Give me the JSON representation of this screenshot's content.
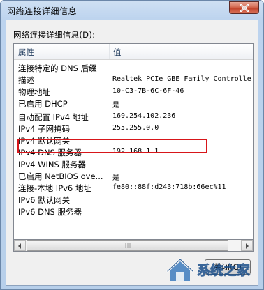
{
  "window": {
    "title": "网络连接详细信息",
    "close_icon": "close-x-icon"
  },
  "section_label": "网络连接详细信息(D):",
  "columns": {
    "property": "属性",
    "value": "值"
  },
  "rows": [
    {
      "name": "连接特定的 DNS 后缀",
      "value": ""
    },
    {
      "name": "描述",
      "value": "Realtek PCIe GBE Family Controlle"
    },
    {
      "name": "物理地址",
      "value": "10-C3-7B-6C-6F-46"
    },
    {
      "name": "已启用 DHCP",
      "value": "是"
    },
    {
      "name": "自动配置 IPv4 地址",
      "value": "169.254.102.236"
    },
    {
      "name": "IPv4 子网掩码",
      "value": "255.255.0.0"
    },
    {
      "name": "IPv4 默认网关",
      "value": ""
    },
    {
      "name": "IPv4 DNS 服务器",
      "value": "192.168.1.1"
    },
    {
      "name": "IPv4 WINS 服务器",
      "value": ""
    },
    {
      "name": "已启用 NetBIOS ove...",
      "value": "是"
    },
    {
      "name": "连接-本地 IPv6 地址",
      "value": "fe80::88f:d243:718b:66ec%11"
    },
    {
      "name": "IPv6 默认网关",
      "value": ""
    },
    {
      "name": "IPv6 DNS 服务器",
      "value": ""
    }
  ],
  "highlight_color": "#d7161a",
  "close_button_label": "关闭(C)",
  "watermark_text": "系统之家"
}
